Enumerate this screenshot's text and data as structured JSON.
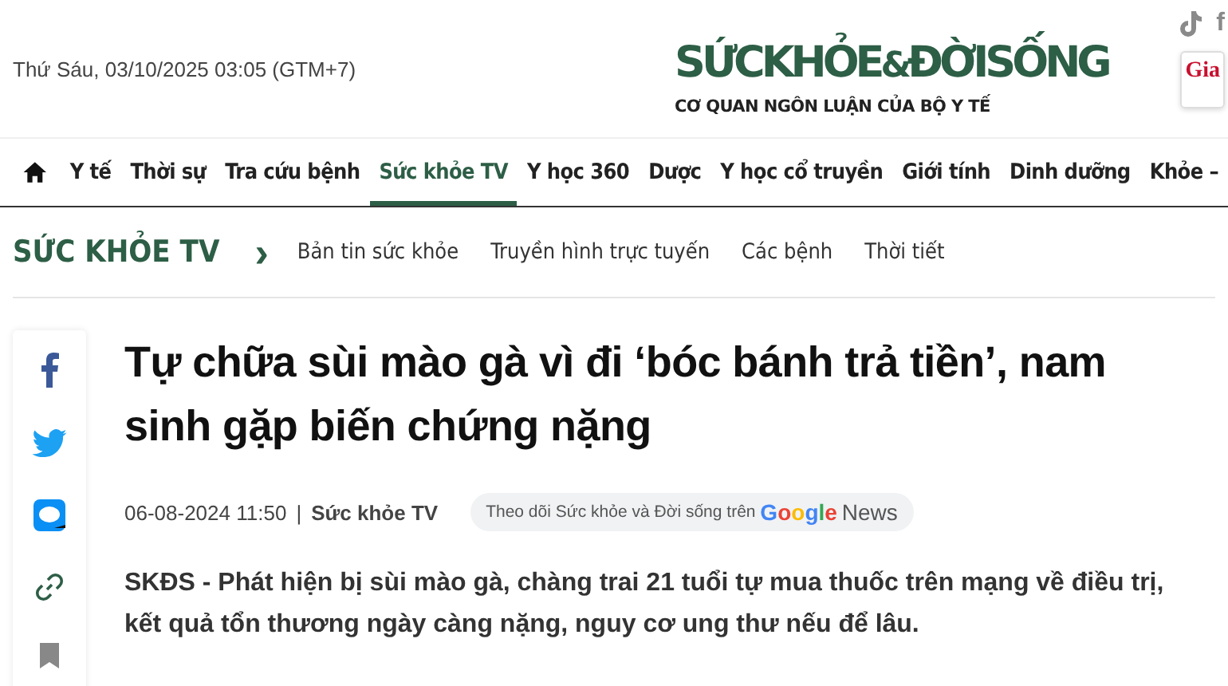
{
  "header": {
    "date": "Thứ Sáu, 03/10/2025 03:05 (GTM+7)",
    "logo": {
      "left": "SỨCKHỎE",
      "amp": "&",
      "right": "ĐỜISỐNG",
      "tagline": "CƠ QUAN NGÔN LUẬN CỦA BỘ Y TẾ"
    },
    "social_partial": "f",
    "ad_partial": "Gia"
  },
  "nav": [
    {
      "label": "Y tế",
      "selected": false
    },
    {
      "label": "Thời sự",
      "selected": false
    },
    {
      "label": "Tra cứu bệnh",
      "selected": false
    },
    {
      "label": "Sức khỏe TV",
      "selected": true
    },
    {
      "label": "Y học 360",
      "selected": false
    },
    {
      "label": "Dược",
      "selected": false
    },
    {
      "label": "Y học cổ truyền",
      "selected": false
    },
    {
      "label": "Giới tính",
      "selected": false
    },
    {
      "label": "Dinh dưỡng",
      "selected": false
    },
    {
      "label": "Khỏe –",
      "selected": false
    }
  ],
  "section": {
    "title": "SỨC KHỎE TV",
    "separator": "›",
    "subnav": [
      "Bản tin sức khỏe",
      "Truyền hình trực tuyến",
      "Các bệnh",
      "Thời tiết"
    ]
  },
  "article": {
    "title": "Tự chữa sùi mào gà vì đi ‘bóc bánh trả tiền’, nam sinh gặp biến chứng nặng",
    "date": "06-08-2024 11:50",
    "separator": "|",
    "category": "Sức khỏe TV",
    "follow": {
      "text": "Theo dõi Sức khỏe và Đời sống trên",
      "brand": "Google",
      "suffix": "News"
    },
    "lead": "**SKĐS** - Phát hiện bị sùi mào gà, chàng trai 21 tuổi tự mua thuốc trên mạng về điều trị, kết quả tổn thương ngày càng nặng, nguy cơ ung thư nếu để lâu."
  }
}
